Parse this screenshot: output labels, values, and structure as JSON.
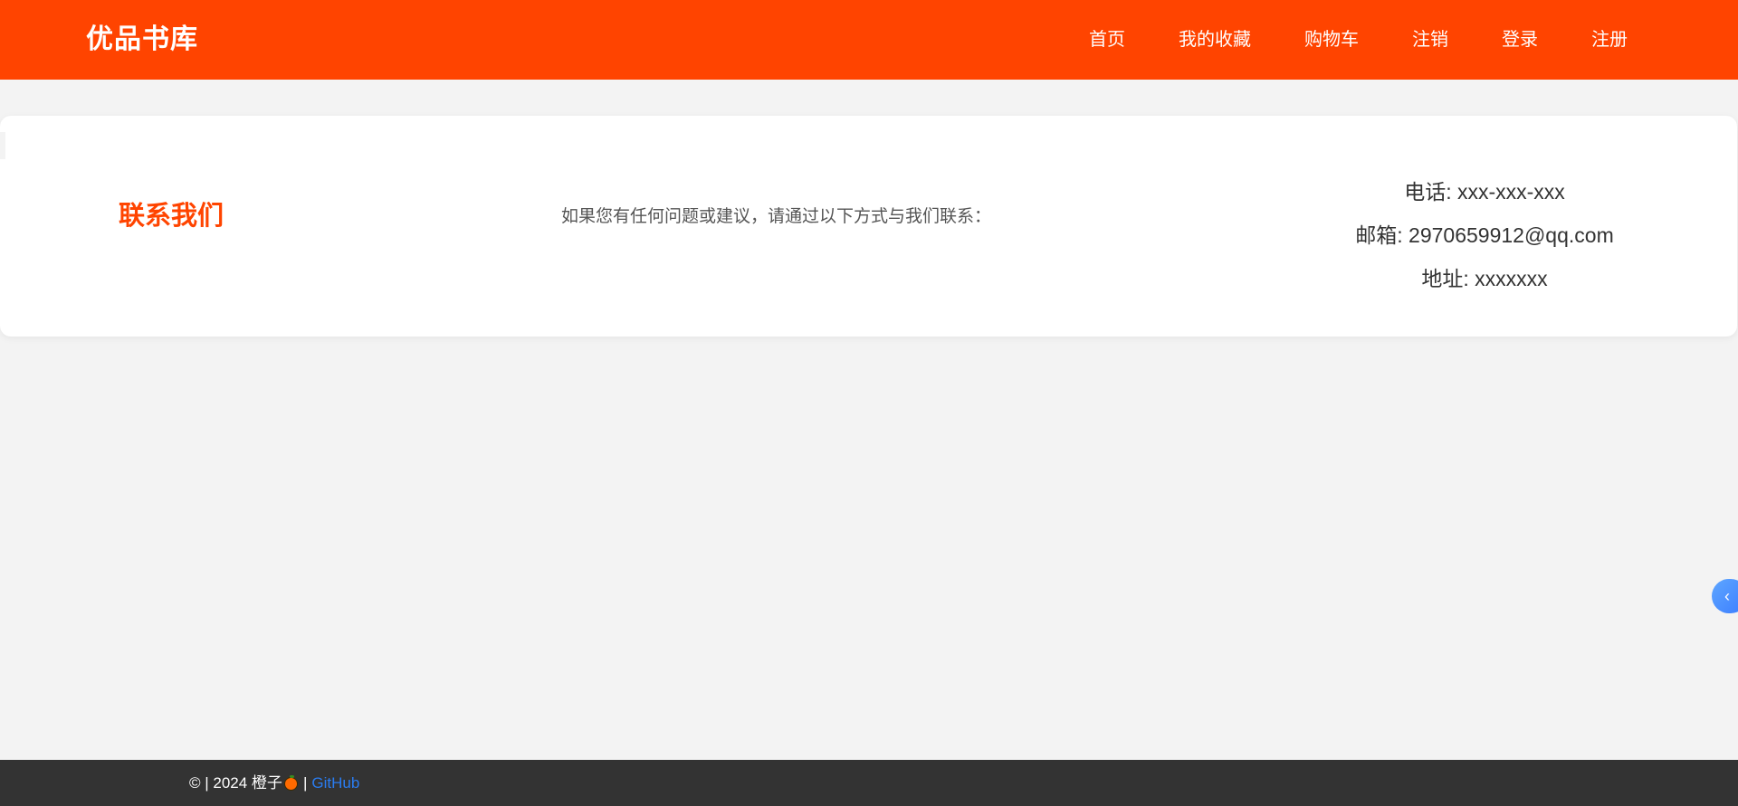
{
  "header": {
    "brand": "优品书库",
    "nav": [
      {
        "label": "首页"
      },
      {
        "label": "我的收藏"
      },
      {
        "label": "购物车"
      },
      {
        "label": "注销"
      },
      {
        "label": "登录"
      },
      {
        "label": "注册"
      }
    ],
    "background_color": "#ff4400"
  },
  "contact": {
    "title": "联系我们",
    "description": "如果您有任何问题或建议，请通过以下方式与我们联系：",
    "phone": "电话: xxx-xxx-xxx",
    "email": "邮箱: 2970659912@qq.com",
    "address": "地址: xxxxxxx",
    "accent_color": "#ff4400"
  },
  "side_toggle": {
    "glyph": "‹",
    "icon": "chevron-left-icon"
  },
  "footer": {
    "copyright": "© | 2024 橙子",
    "icon": "orange-icon",
    "separator": "|",
    "link_label": "GitHub",
    "background_color": "#333333",
    "link_color": "#2a7cf0"
  }
}
